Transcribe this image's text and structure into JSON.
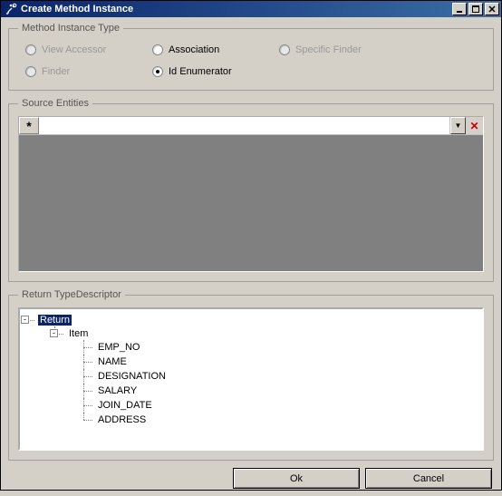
{
  "window": {
    "title": "Create Method Instance"
  },
  "groups": {
    "method_type": "Method Instance Type",
    "source": "Source Entities",
    "return": "Return TypeDescriptor"
  },
  "radios": {
    "view_accessor": "View Accessor",
    "association": "Association",
    "specific_finder": "Specific Finder",
    "finder": "Finder",
    "id_enumerator": "Id Enumerator"
  },
  "tree": {
    "root": "Return",
    "item": "Item",
    "fields": {
      "0": "EMP_NO",
      "1": "NAME",
      "2": "DESIGNATION",
      "3": "SALARY",
      "4": "JOIN_DATE",
      "5": "ADDRESS"
    }
  },
  "buttons": {
    "ok": "Ok",
    "cancel": "Cancel"
  },
  "glyphs": {
    "new_row": "*",
    "dropdown": "▼",
    "delete": "✕",
    "minus": "-"
  }
}
